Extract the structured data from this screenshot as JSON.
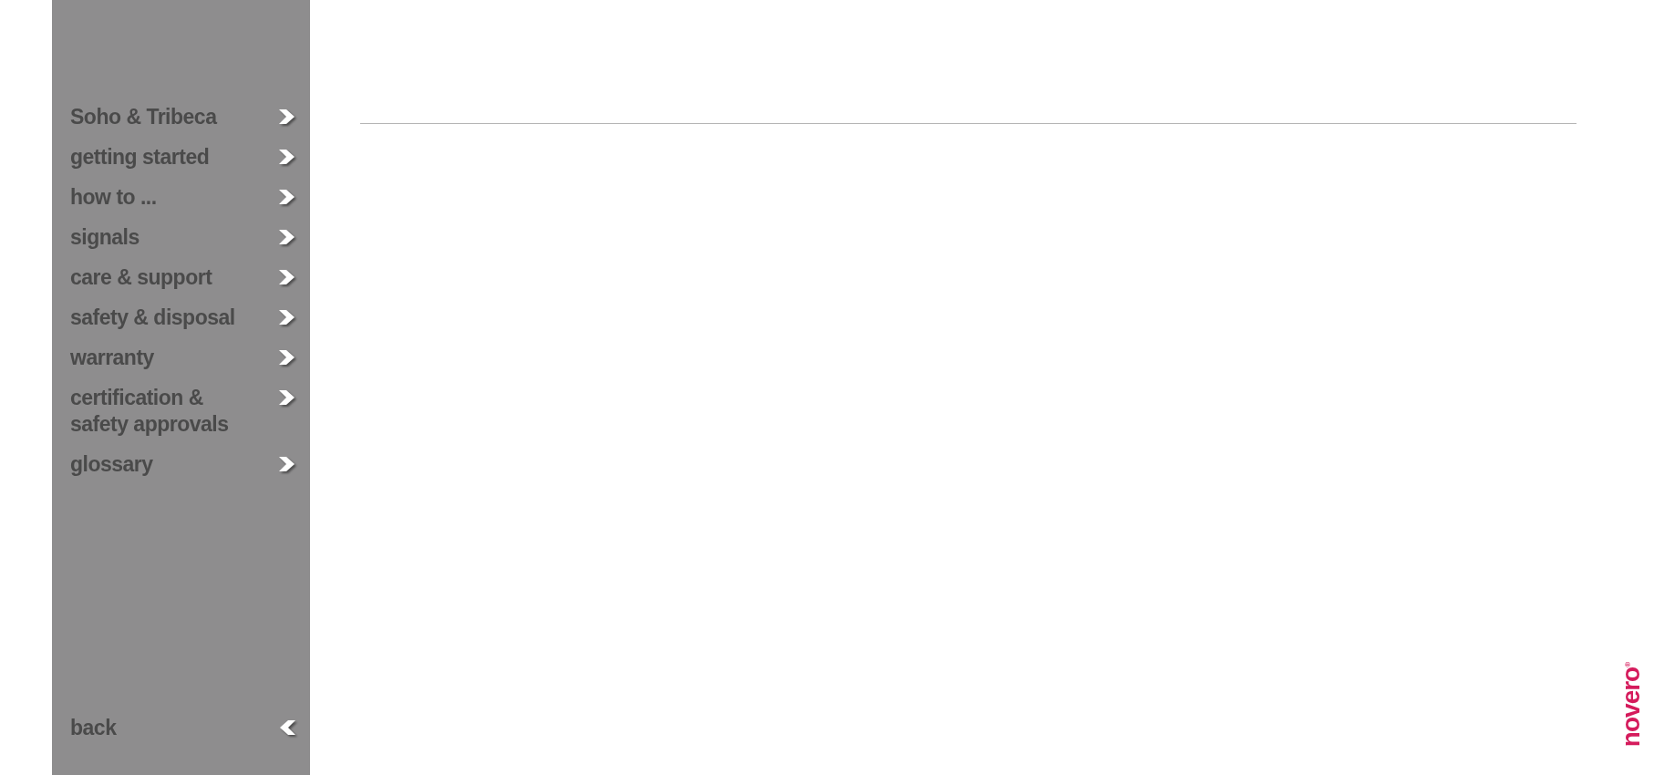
{
  "sidebar": {
    "items": [
      {
        "label": "Soho & Tribeca"
      },
      {
        "label": "getting started"
      },
      {
        "label": "how to ..."
      },
      {
        "label": "signals"
      },
      {
        "label": "care & support"
      },
      {
        "label": "safety & disposal"
      },
      {
        "label": "warranty"
      },
      {
        "label": "certification & safety approvals"
      },
      {
        "label": "glossary"
      }
    ],
    "back": {
      "label": "back"
    }
  },
  "logo": {
    "text": "novero",
    "mark": "®"
  }
}
